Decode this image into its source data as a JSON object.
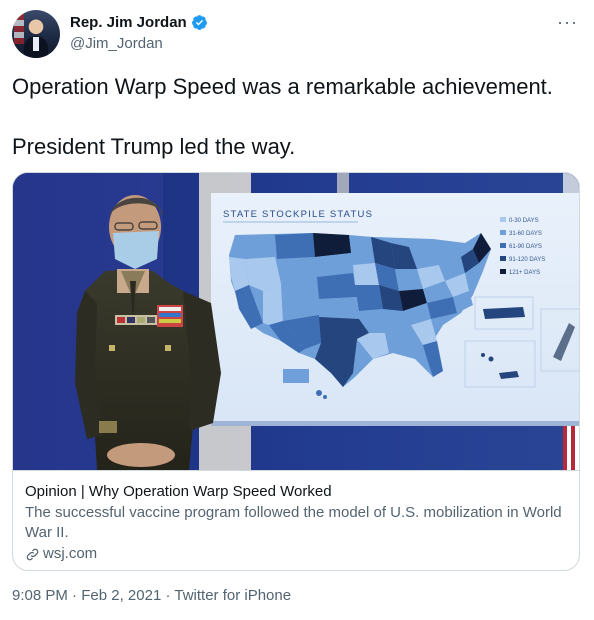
{
  "author": {
    "name": "Rep. Jim Jordan",
    "handle": "@Jim_Jordan",
    "verified_color": "#1d9bf0"
  },
  "menu": {
    "more_label": "···"
  },
  "tweet": {
    "paragraphs": [
      "Operation Warp Speed was a remarkable achievement.",
      "President Trump led the way."
    ]
  },
  "card": {
    "image": {
      "map_title": "STATE STOCKPILE STATUS",
      "legend": [
        {
          "label": "0-30 DAYS",
          "color": "#a9c8ee"
        },
        {
          "label": "31-60 DAYS",
          "color": "#6f9fd8"
        },
        {
          "label": "61-90 DAYS",
          "color": "#3e6fb4"
        },
        {
          "label": "91-120 DAYS",
          "color": "#24457e"
        },
        {
          "label": "121+ DAYS",
          "color": "#0f1c3a"
        }
      ]
    },
    "title": "Opinion | Why Operation Warp Speed Worked",
    "description": "The successful vaccine program followed the model of U.S. mobilization in World War II.",
    "domain": "wsj.com"
  },
  "meta": {
    "time": "9:08 PM",
    "date": "Feb 2, 2021",
    "source": "Twitter for iPhone"
  }
}
